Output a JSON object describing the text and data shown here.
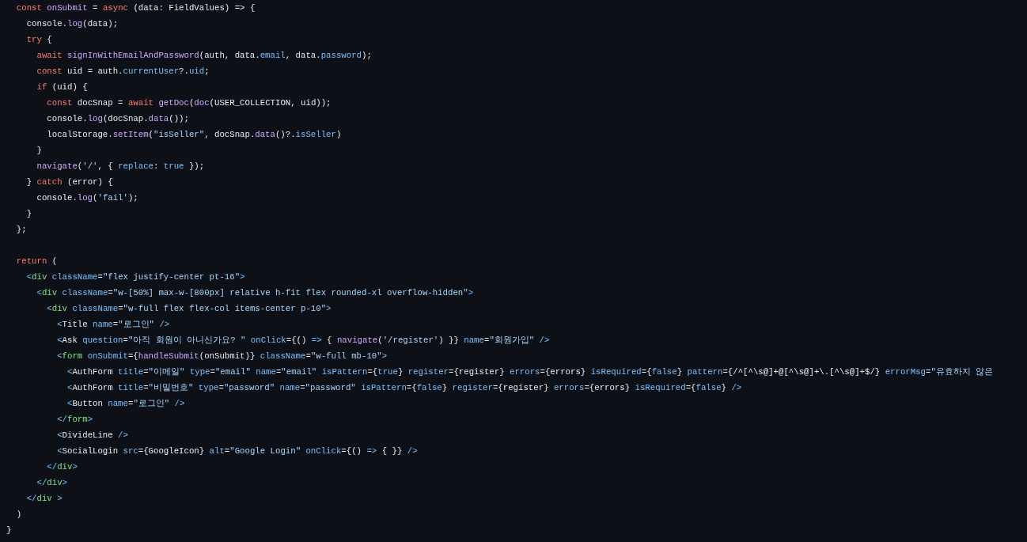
{
  "code_blocks": [
    [
      {
        "tokens": [
          {
            "kind": "kw",
            "text": "  const"
          },
          {
            "kind": "fn",
            "text": " onSubmit"
          },
          {
            "kind": "txt",
            "text": " = "
          },
          {
            "kind": "kw",
            "text": "async"
          },
          {
            "kind": "txt",
            "text": " (data: FieldValues) => {"
          }
        ]
      },
      {
        "tokens": [
          {
            "kind": "txt",
            "text": "    console."
          },
          {
            "kind": "fn",
            "text": "log"
          },
          {
            "kind": "txt",
            "text": "(data);"
          }
        ]
      },
      {
        "tokens": [
          {
            "kind": "kw",
            "text": "    try"
          },
          {
            "kind": "txt",
            "text": " {"
          }
        ]
      },
      {
        "tokens": [
          {
            "kind": "kw",
            "text": "      await"
          },
          {
            "kind": "fn",
            "text": " signInWithEmailAndPassword"
          },
          {
            "kind": "txt",
            "text": "(auth, data."
          },
          {
            "kind": "prop",
            "text": "email"
          },
          {
            "kind": "txt",
            "text": ", data."
          },
          {
            "kind": "prop",
            "text": "password"
          },
          {
            "kind": "txt",
            "text": ");"
          }
        ]
      },
      {
        "tokens": [
          {
            "kind": "kw",
            "text": "      const"
          },
          {
            "kind": "txt",
            "text": " uid = auth."
          },
          {
            "kind": "prop",
            "text": "currentUser"
          },
          {
            "kind": "txt",
            "text": "?."
          },
          {
            "kind": "prop",
            "text": "uid"
          },
          {
            "kind": "txt",
            "text": ";"
          }
        ]
      },
      {
        "tokens": [
          {
            "kind": "kw",
            "text": "      if"
          },
          {
            "kind": "txt",
            "text": " (uid) {"
          }
        ]
      },
      {
        "tokens": [
          {
            "kind": "kw",
            "text": "        const"
          },
          {
            "kind": "txt",
            "text": " docSnap = "
          },
          {
            "kind": "kw",
            "text": "await"
          },
          {
            "kind": "fn",
            "text": " getDoc"
          },
          {
            "kind": "txt",
            "text": "("
          },
          {
            "kind": "fn",
            "text": "doc"
          },
          {
            "kind": "txt",
            "text": "(USER_COLLECTION, uid));"
          }
        ]
      },
      {
        "tokens": [
          {
            "kind": "txt",
            "text": "        console."
          },
          {
            "kind": "fn",
            "text": "log"
          },
          {
            "kind": "txt",
            "text": "(docSnap."
          },
          {
            "kind": "fn",
            "text": "data"
          },
          {
            "kind": "txt",
            "text": "());"
          }
        ]
      },
      {
        "tokens": [
          {
            "kind": "txt",
            "text": "        localStorage."
          },
          {
            "kind": "fn",
            "text": "setItem"
          },
          {
            "kind": "txt",
            "text": "("
          },
          {
            "kind": "str",
            "text": "\"isSeller\""
          },
          {
            "kind": "txt",
            "text": ", docSnap."
          },
          {
            "kind": "fn",
            "text": "data"
          },
          {
            "kind": "txt",
            "text": "()?."
          },
          {
            "kind": "prop",
            "text": "isSeller"
          },
          {
            "kind": "txt",
            "text": ")"
          }
        ]
      },
      {
        "tokens": [
          {
            "kind": "txt",
            "text": "      }"
          }
        ]
      },
      {
        "tokens": [
          {
            "kind": "fn",
            "text": "      navigate"
          },
          {
            "kind": "txt",
            "text": "("
          },
          {
            "kind": "str",
            "text": "'/'"
          },
          {
            "kind": "txt",
            "text": ", { "
          },
          {
            "kind": "prop",
            "text": "replace"
          },
          {
            "kind": "txt",
            "text": ": "
          },
          {
            "kind": "prop",
            "text": "true"
          },
          {
            "kind": "txt",
            "text": " });"
          }
        ]
      },
      {
        "tokens": [
          {
            "kind": "txt",
            "text": "    } "
          },
          {
            "kind": "kw",
            "text": "catch"
          },
          {
            "kind": "txt",
            "text": " (error) {"
          }
        ]
      },
      {
        "tokens": [
          {
            "kind": "txt",
            "text": "      console."
          },
          {
            "kind": "fn",
            "text": "log"
          },
          {
            "kind": "txt",
            "text": "("
          },
          {
            "kind": "str",
            "text": "'fail'"
          },
          {
            "kind": "txt",
            "text": ");"
          }
        ]
      },
      {
        "tokens": [
          {
            "kind": "txt",
            "text": "    }"
          }
        ]
      },
      {
        "tokens": [
          {
            "kind": "txt",
            "text": "  };"
          }
        ]
      }
    ],
    [
      {
        "tokens": [
          {
            "kind": "kw",
            "text": "  return"
          },
          {
            "kind": "txt",
            "text": " ("
          }
        ]
      },
      {
        "tokens": [
          {
            "kind": "prop",
            "text": "    <"
          },
          {
            "kind": "tag",
            "text": "div"
          },
          {
            "kind": "prop",
            "text": " className"
          },
          {
            "kind": "txt",
            "text": "="
          },
          {
            "kind": "str",
            "text": "\"flex justify-center pt-16\""
          },
          {
            "kind": "prop",
            "text": ">"
          }
        ]
      },
      {
        "tokens": [
          {
            "kind": "prop",
            "text": "      <"
          },
          {
            "kind": "tag",
            "text": "div"
          },
          {
            "kind": "prop",
            "text": " className"
          },
          {
            "kind": "txt",
            "text": "="
          },
          {
            "kind": "str",
            "text": "\"w-[50%] max-w-[800px] relative h-fit flex rounded-xl overflow-hidden\""
          },
          {
            "kind": "prop",
            "text": ">"
          }
        ]
      },
      {
        "tokens": [
          {
            "kind": "prop",
            "text": "        <"
          },
          {
            "kind": "tag",
            "text": "div"
          },
          {
            "kind": "prop",
            "text": " className"
          },
          {
            "kind": "txt",
            "text": "="
          },
          {
            "kind": "str",
            "text": "\"w-full flex flex-col items-center p-10\""
          },
          {
            "kind": "prop",
            "text": ">"
          }
        ]
      },
      {
        "tokens": [
          {
            "kind": "prop",
            "text": "          <"
          },
          {
            "kind": "txt",
            "text": "Title"
          },
          {
            "kind": "prop",
            "text": " name"
          },
          {
            "kind": "txt",
            "text": "="
          },
          {
            "kind": "str",
            "text": "\"로그인\""
          },
          {
            "kind": "prop",
            "text": " />"
          }
        ]
      },
      {
        "tokens": [
          {
            "kind": "prop",
            "text": "          <"
          },
          {
            "kind": "txt",
            "text": "Ask"
          },
          {
            "kind": "prop",
            "text": " question"
          },
          {
            "kind": "txt",
            "text": "="
          },
          {
            "kind": "str",
            "text": "\"아직 회원이 아니신가요? \""
          },
          {
            "kind": "prop",
            "text": " onClick"
          },
          {
            "kind": "txt",
            "text": "={() "
          },
          {
            "kind": "prop",
            "text": "=>"
          },
          {
            "kind": "txt",
            "text": " { "
          },
          {
            "kind": "fn",
            "text": "navigate"
          },
          {
            "kind": "txt",
            "text": "("
          },
          {
            "kind": "str",
            "text": "'/register'"
          },
          {
            "kind": "txt",
            "text": ") }}"
          },
          {
            "kind": "prop",
            "text": " name"
          },
          {
            "kind": "txt",
            "text": "="
          },
          {
            "kind": "str",
            "text": "\"회원가입\""
          },
          {
            "kind": "prop",
            "text": " />"
          }
        ]
      },
      {
        "tokens": [
          {
            "kind": "prop",
            "text": "          <"
          },
          {
            "kind": "tag",
            "text": "form"
          },
          {
            "kind": "prop",
            "text": " onSubmit"
          },
          {
            "kind": "txt",
            "text": "={"
          },
          {
            "kind": "fn",
            "text": "handleSubmit"
          },
          {
            "kind": "txt",
            "text": "(onSubmit)}"
          },
          {
            "kind": "prop",
            "text": " className"
          },
          {
            "kind": "txt",
            "text": "="
          },
          {
            "kind": "str",
            "text": "\"w-full mb-10\""
          },
          {
            "kind": "prop",
            "text": ">"
          }
        ]
      },
      {
        "tokens": [
          {
            "kind": "prop",
            "text": "            <"
          },
          {
            "kind": "txt",
            "text": "AuthForm"
          },
          {
            "kind": "prop",
            "text": " title"
          },
          {
            "kind": "txt",
            "text": "="
          },
          {
            "kind": "str",
            "text": "\"이메일\""
          },
          {
            "kind": "prop",
            "text": " type"
          },
          {
            "kind": "txt",
            "text": "="
          },
          {
            "kind": "str",
            "text": "\"email\""
          },
          {
            "kind": "prop",
            "text": " name"
          },
          {
            "kind": "txt",
            "text": "="
          },
          {
            "kind": "str",
            "text": "\"email\""
          },
          {
            "kind": "prop",
            "text": " isPattern"
          },
          {
            "kind": "txt",
            "text": "={"
          },
          {
            "kind": "prop",
            "text": "true"
          },
          {
            "kind": "txt",
            "text": "}"
          },
          {
            "kind": "prop",
            "text": " register"
          },
          {
            "kind": "txt",
            "text": "={register}"
          },
          {
            "kind": "prop",
            "text": " errors"
          },
          {
            "kind": "txt",
            "text": "={errors}"
          },
          {
            "kind": "prop",
            "text": " isRequired"
          },
          {
            "kind": "txt",
            "text": "={"
          },
          {
            "kind": "prop",
            "text": "false"
          },
          {
            "kind": "txt",
            "text": "}"
          },
          {
            "kind": "prop",
            "text": " pattern"
          },
          {
            "kind": "txt",
            "text": "={/^[^\\s@]+@[^\\s@]+\\.[^\\s@]+$/}"
          },
          {
            "kind": "prop",
            "text": " errorMsg"
          },
          {
            "kind": "txt",
            "text": "="
          },
          {
            "kind": "str",
            "text": "\"유효하지 않은"
          }
        ]
      },
      {
        "tokens": [
          {
            "kind": "prop",
            "text": "            <"
          },
          {
            "kind": "txt",
            "text": "AuthForm"
          },
          {
            "kind": "prop",
            "text": " title"
          },
          {
            "kind": "txt",
            "text": "="
          },
          {
            "kind": "str",
            "text": "\"비밀번호\""
          },
          {
            "kind": "prop",
            "text": " type"
          },
          {
            "kind": "txt",
            "text": "="
          },
          {
            "kind": "str",
            "text": "\"password\""
          },
          {
            "kind": "prop",
            "text": " name"
          },
          {
            "kind": "txt",
            "text": "="
          },
          {
            "kind": "str",
            "text": "\"password\""
          },
          {
            "kind": "prop",
            "text": " isPattern"
          },
          {
            "kind": "txt",
            "text": "={"
          },
          {
            "kind": "prop",
            "text": "false"
          },
          {
            "kind": "txt",
            "text": "}"
          },
          {
            "kind": "prop",
            "text": " register"
          },
          {
            "kind": "txt",
            "text": "={register}"
          },
          {
            "kind": "prop",
            "text": " errors"
          },
          {
            "kind": "txt",
            "text": "={errors}"
          },
          {
            "kind": "prop",
            "text": " isRequired"
          },
          {
            "kind": "txt",
            "text": "={"
          },
          {
            "kind": "prop",
            "text": "false"
          },
          {
            "kind": "txt",
            "text": "}"
          },
          {
            "kind": "prop",
            "text": " />"
          }
        ]
      },
      {
        "tokens": [
          {
            "kind": "prop",
            "text": "            <"
          },
          {
            "kind": "txt",
            "text": "Button"
          },
          {
            "kind": "prop",
            "text": " name"
          },
          {
            "kind": "txt",
            "text": "="
          },
          {
            "kind": "str",
            "text": "\"로그인\""
          },
          {
            "kind": "prop",
            "text": " />"
          }
        ]
      },
      {
        "tokens": [
          {
            "kind": "prop",
            "text": "          </"
          },
          {
            "kind": "tag",
            "text": "form"
          },
          {
            "kind": "prop",
            "text": ">"
          }
        ]
      },
      {
        "tokens": [
          {
            "kind": "prop",
            "text": "          <"
          },
          {
            "kind": "txt",
            "text": "DivideLine"
          },
          {
            "kind": "prop",
            "text": " />"
          }
        ]
      },
      {
        "tokens": [
          {
            "kind": "prop",
            "text": "          <"
          },
          {
            "kind": "txt",
            "text": "SocialLogin"
          },
          {
            "kind": "prop",
            "text": " src"
          },
          {
            "kind": "txt",
            "text": "={GoogleIcon}"
          },
          {
            "kind": "prop",
            "text": " alt"
          },
          {
            "kind": "txt",
            "text": "="
          },
          {
            "kind": "str",
            "text": "\"Google Login\""
          },
          {
            "kind": "prop",
            "text": " onClick"
          },
          {
            "kind": "txt",
            "text": "={() "
          },
          {
            "kind": "prop",
            "text": "=>"
          },
          {
            "kind": "txt",
            "text": " { }}"
          },
          {
            "kind": "prop",
            "text": " />"
          }
        ]
      },
      {
        "tokens": [
          {
            "kind": "prop",
            "text": "        </"
          },
          {
            "kind": "tag",
            "text": "div"
          },
          {
            "kind": "prop",
            "text": ">"
          }
        ]
      },
      {
        "tokens": [
          {
            "kind": "prop",
            "text": "      </"
          },
          {
            "kind": "tag",
            "text": "div"
          },
          {
            "kind": "prop",
            "text": ">"
          }
        ]
      },
      {
        "tokens": [
          {
            "kind": "prop",
            "text": "    </"
          },
          {
            "kind": "tag",
            "text": "div"
          },
          {
            "kind": "prop",
            "text": " >"
          }
        ]
      },
      {
        "tokens": [
          {
            "kind": "txt",
            "text": "  )"
          }
        ]
      },
      {
        "tokens": [
          {
            "kind": "txt",
            "text": "}"
          }
        ]
      }
    ]
  ]
}
